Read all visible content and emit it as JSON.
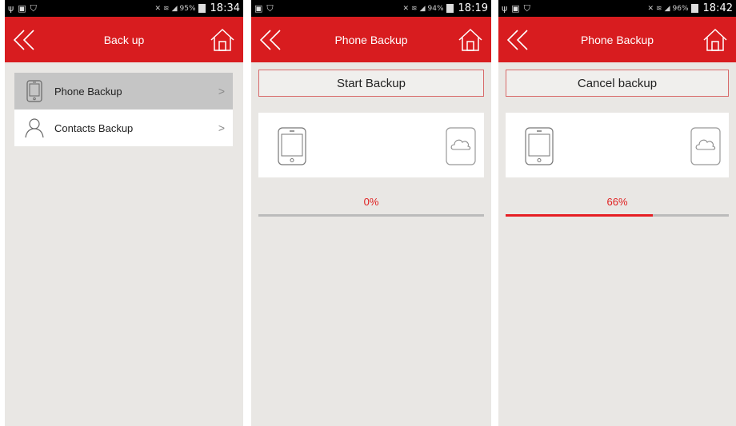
{
  "screens": [
    {
      "status": {
        "left_icons": [
          "usb-icon",
          "image-icon",
          "briefcase-icon"
        ],
        "battery": "95%",
        "time": "18:34"
      },
      "title": "Back up",
      "list": [
        {
          "label": "Phone Backup",
          "icon": "phone-icon",
          "selected": true
        },
        {
          "label": "Contacts Backup",
          "icon": "person-icon",
          "selected": false
        }
      ]
    },
    {
      "status": {
        "left_icons": [
          "image-icon",
          "briefcase-icon"
        ],
        "battery": "94%",
        "time": "18:19"
      },
      "title": "Phone Backup",
      "button_label": "Start Backup",
      "progress_label": "0%",
      "progress": 0
    },
    {
      "status": {
        "left_icons": [
          "usb-icon",
          "image-icon",
          "briefcase-icon"
        ],
        "battery": "96%",
        "time": "18:42"
      },
      "title": "Phone Backup",
      "button_label": "Cancel backup",
      "progress_label": "66%",
      "progress": 0.66
    }
  ],
  "colors": {
    "accent": "#d81c1f",
    "progress": "#e61e23"
  }
}
